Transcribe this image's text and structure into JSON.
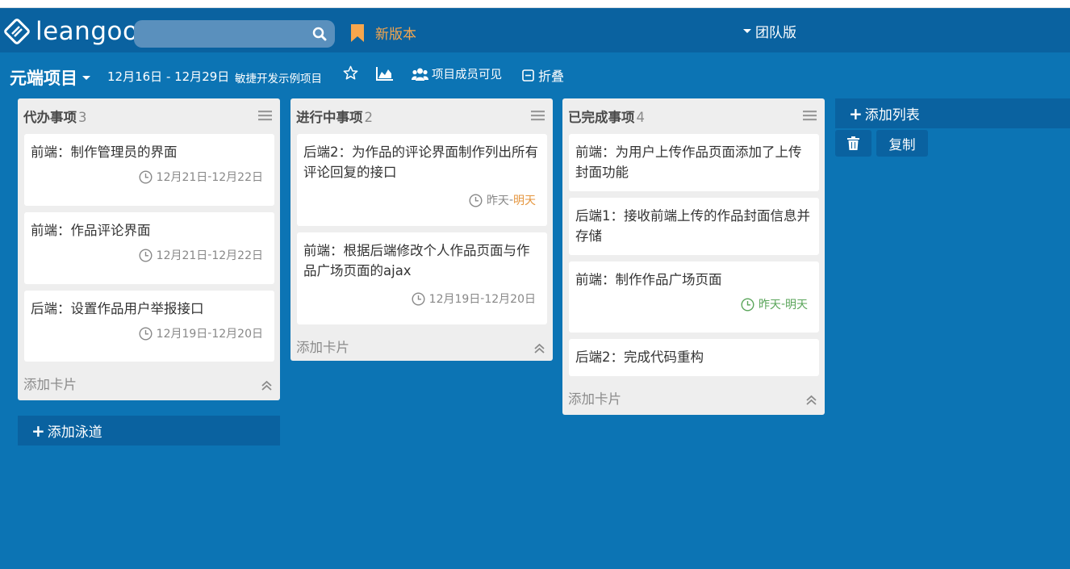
{
  "header": {
    "logo_text": "leangoo",
    "search": {
      "placeholder": "",
      "value": ""
    },
    "new_version_label": "新版本",
    "team_label": "团队版"
  },
  "project": {
    "title": "元端项目",
    "date_range": "12月16日 - 12月29日",
    "description": "敏捷开发示例项目",
    "members_label": "项目成员可见",
    "fold_label": "折叠"
  },
  "lists": [
    {
      "title": "代办事项",
      "count": "3",
      "cards": [
        {
          "title": "前端：制作管理员的界面",
          "due": {
            "start": "12月21日",
            "sep": " - ",
            "end": "12月22日"
          }
        },
        {
          "title": "前端：作品评论界面",
          "due": {
            "start": "12月21日",
            "sep": " - ",
            "end": "12月22日"
          }
        },
        {
          "title": "后端：设置作品用户举报接口",
          "due": {
            "start": "12月19日",
            "sep": " - ",
            "end": "12月20日"
          }
        }
      ],
      "add_card_label": "添加卡片"
    },
    {
      "title": "进行中事项",
      "count": "2",
      "cards": [
        {
          "title": "后端2：为作品的评论界面制作列出所有评论回复的接口",
          "due": {
            "start": "昨天",
            "sep": " - ",
            "end": "明天"
          }
        },
        {
          "title": "前端：根据后端修改个人作品页面与作品广场页面的ajax",
          "due": {
            "start": "12月19日",
            "sep": " - ",
            "end": "12月20日"
          }
        }
      ],
      "add_card_label": "添加卡片"
    },
    {
      "title": "已完成事项",
      "count": "4",
      "cards": [
        {
          "title": "前端：为用户上传作品页面添加了上传封面功能"
        },
        {
          "title": "后端1：接收前端上传的作品封面信息并存储"
        },
        {
          "title": "前端：制作作品广场页面",
          "due": {
            "start": "昨天",
            "sep": " - ",
            "end": "明天"
          }
        },
        {
          "title": "后端2：完成代码重构"
        }
      ],
      "add_card_label": "添加卡片"
    }
  ],
  "add_list_label": "添加列表",
  "copy_label": "复制",
  "add_lane_label": "添加泳道",
  "colors": {
    "background": "#0c74b4",
    "header": "#0a62a0",
    "accent_orange": "#f7a64d",
    "due_green": "#5aa55a"
  },
  "icons": [
    "logo-icon",
    "search-icon",
    "bookmark-icon",
    "caret-down-icon",
    "star-icon",
    "chart-icon",
    "users-icon",
    "minus-square-icon",
    "menu-icon",
    "clock-icon",
    "double-chevron-up-icon",
    "plus-icon",
    "trash-icon"
  ]
}
